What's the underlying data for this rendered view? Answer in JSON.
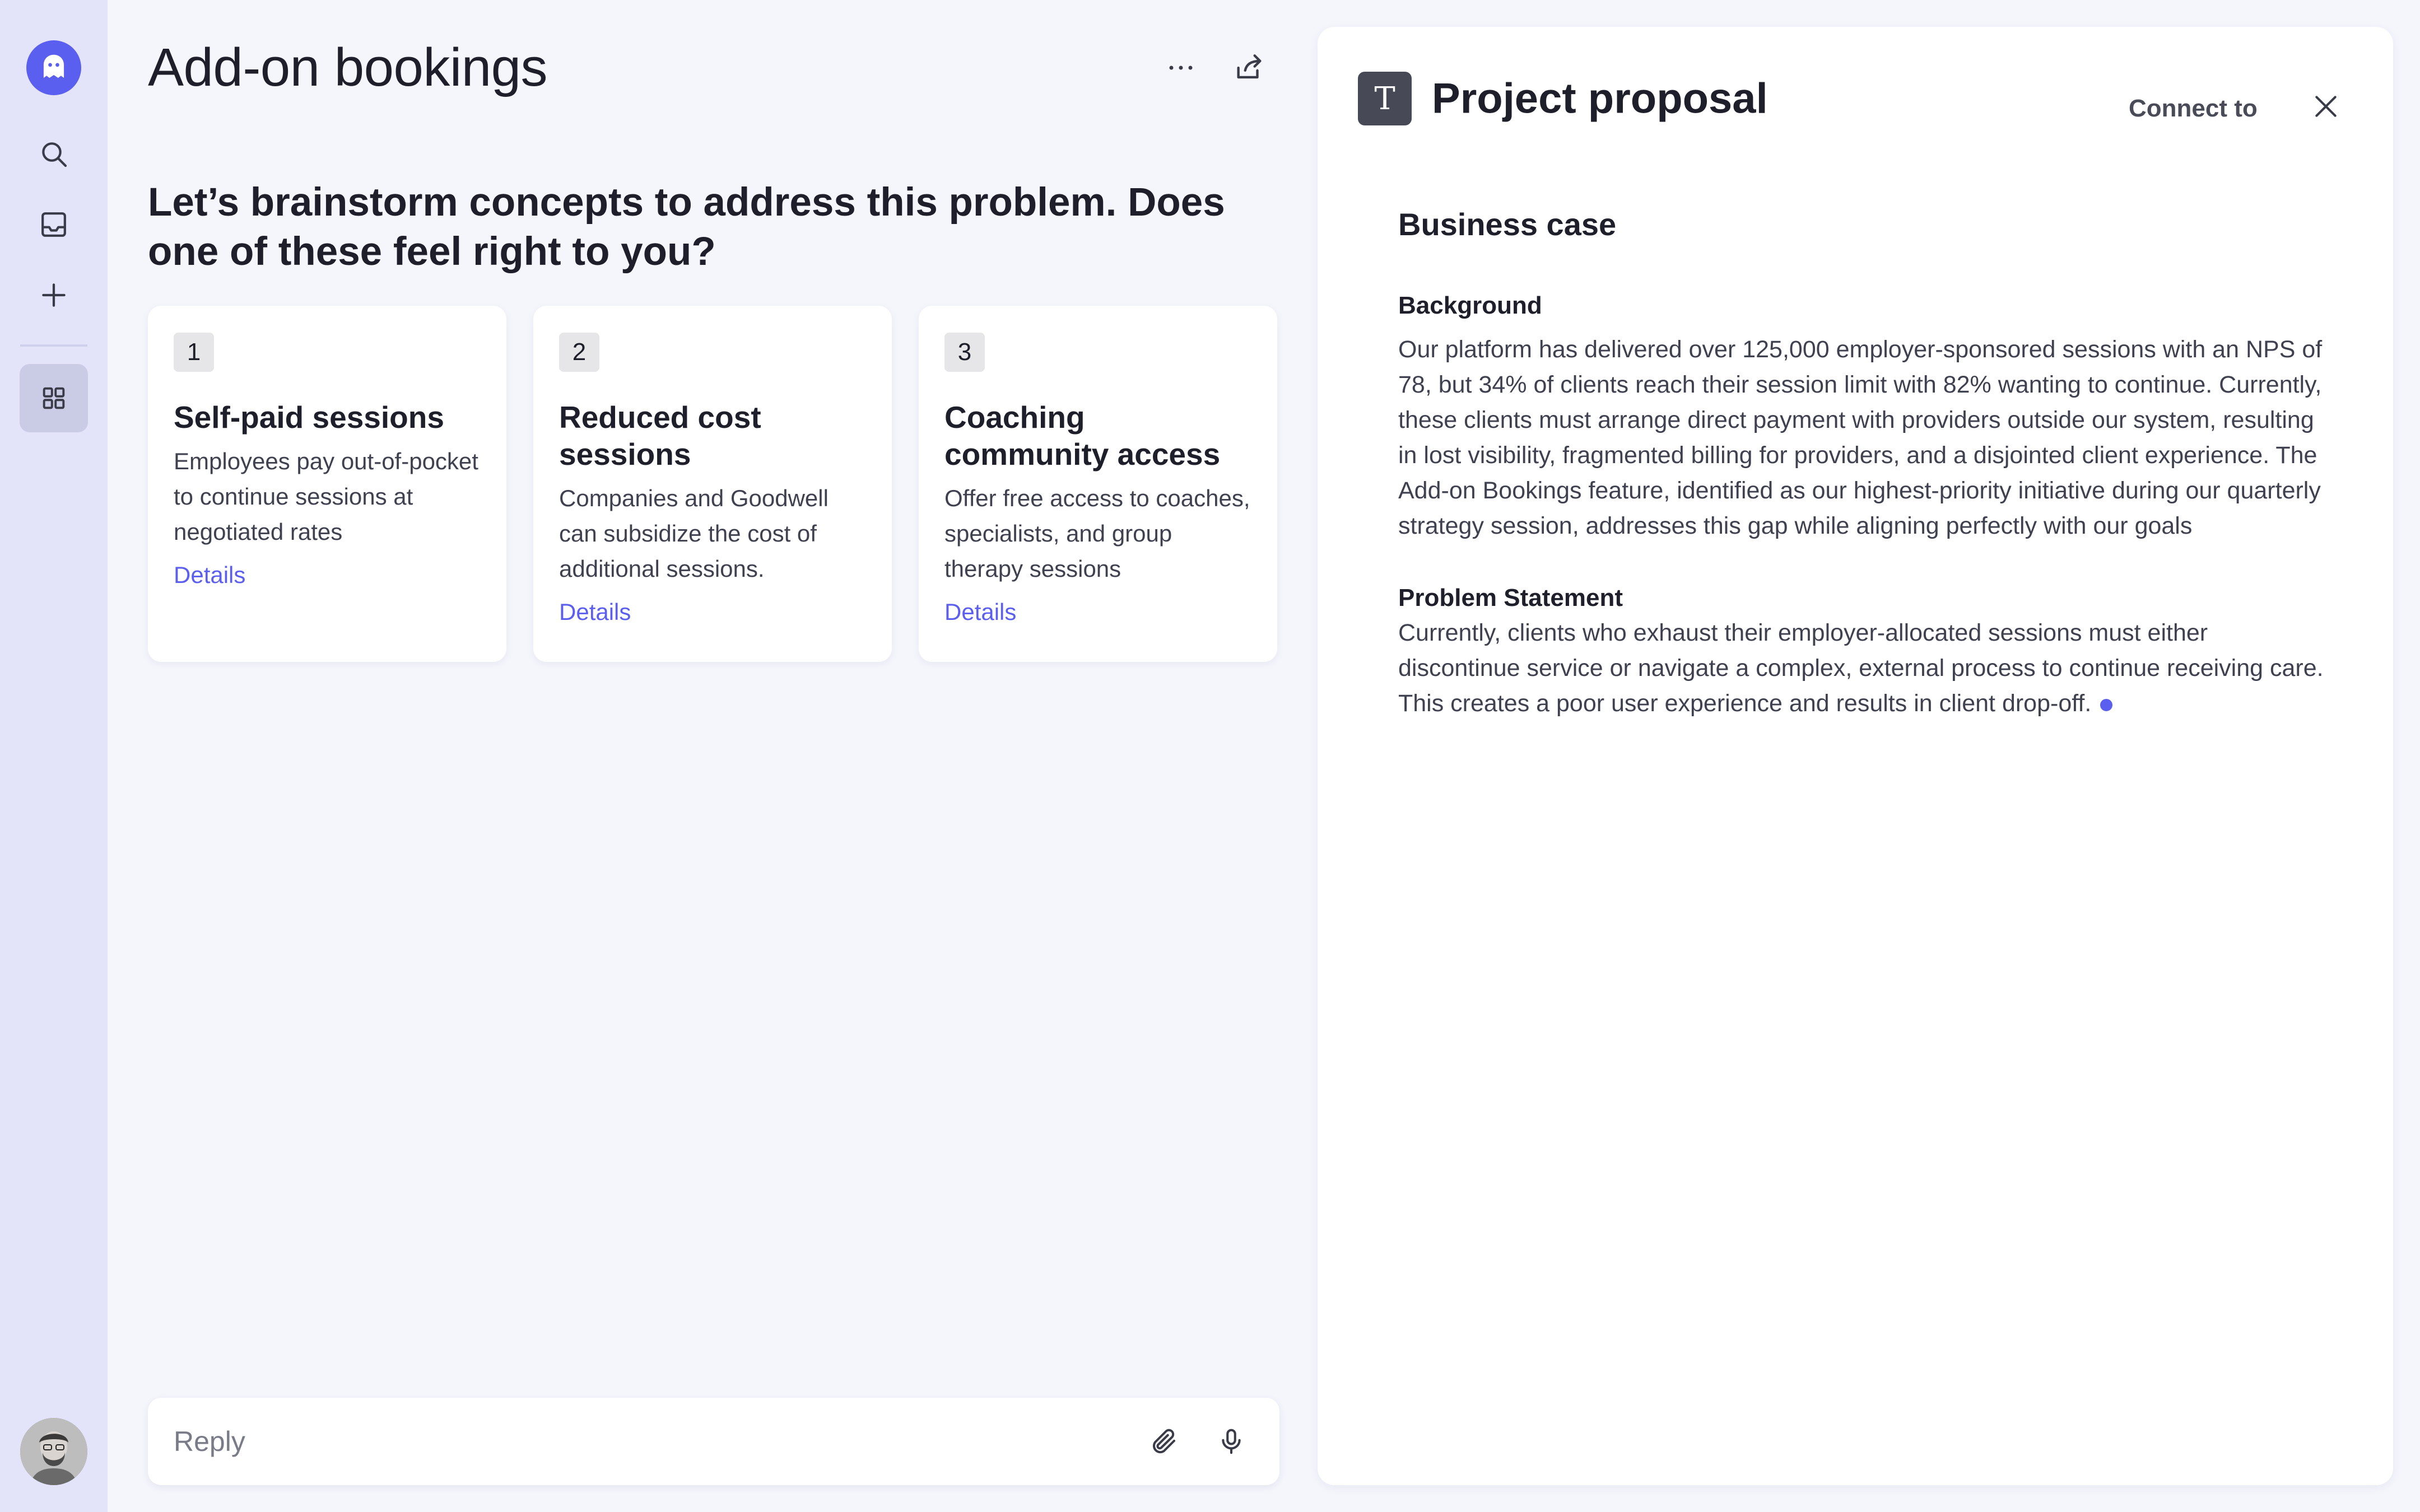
{
  "sidebar": {
    "logo": "ghost-logo-icon",
    "items": [
      {
        "icon": "search-icon"
      },
      {
        "icon": "inbox-icon"
      },
      {
        "icon": "plus-icon"
      },
      {
        "icon": "grid-icon",
        "active": true
      }
    ],
    "accent": "#5b5ff0",
    "background": "#e3e4fa"
  },
  "main": {
    "title": "Add-on bookings",
    "question": "Let’s brainstorm concepts to address this problem. Does one of these feel right to you?",
    "cards": [
      {
        "number": "1",
        "title": "Self-paid sessions",
        "description": "Employees pay out-of-pocket to continue sessions at negotiated rates",
        "link": "Details"
      },
      {
        "number": "2",
        "title": "Reduced cost sessions",
        "description": "Companies and Goodwell can subsidize the cost of additional sessions.",
        "link": "Details"
      },
      {
        "number": "3",
        "title": "Coaching community access",
        "description": "Offer free access to coaches, specialists, and group therapy sessions",
        "link": "Details"
      }
    ],
    "reply": {
      "placeholder": "Reply"
    }
  },
  "panel": {
    "badge": "T",
    "title": "Project proposal",
    "connect_label": "Connect to",
    "heading": "Business case",
    "sections": [
      {
        "title": "Background",
        "body": "Our platform has delivered over 125,000 employer-sponsored sessions with an NPS of 78, but 34% of clients reach their session limit with 82% wanting to continue. Currently, these clients must arrange direct payment with providers outside our system, resulting in lost visibility, fragmented billing for providers, and a disjointed client experience. The Add-on Bookings feature, identified as our highest-priority initiative during our quarterly strategy session, addresses this gap while aligning perfectly with our goals"
      },
      {
        "title": "Problem Statement",
        "body": "Currently, clients who exhaust their employer-allocated sessions must either discontinue service or navigate a complex, external process to continue receiving care. This creates a poor user experience and results in client drop-off."
      }
    ]
  }
}
